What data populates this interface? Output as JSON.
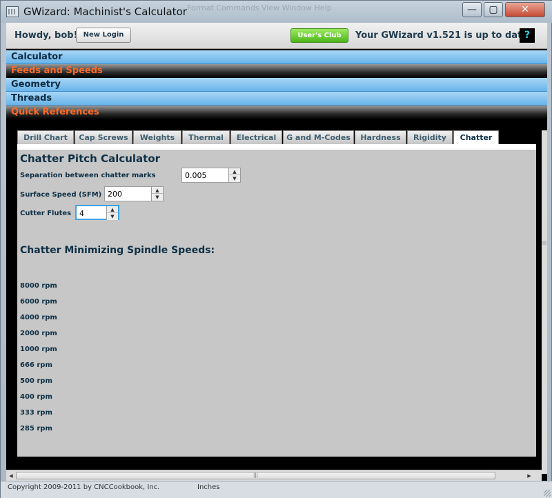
{
  "window": {
    "title": "GWizard: Machinist's Calculator",
    "ghost_menu": "Format    Commands    View    Window    Help",
    "controls": {
      "minimize": "—",
      "maximize": "▢",
      "close": "✕"
    }
  },
  "header": {
    "greeting": "Howdy, bob!",
    "new_login_label": "New Login",
    "users_club_label": "User's Club",
    "version_status": "Your GWizard v1.521 is up to date",
    "help_label": "?"
  },
  "sections": [
    {
      "label": "Calculator",
      "style": "blue"
    },
    {
      "label": "Feeds and Speeds",
      "style": "dark"
    },
    {
      "label": "Geometry",
      "style": "blue"
    },
    {
      "label": "Threads",
      "style": "blue"
    },
    {
      "label": "Quick References",
      "style": "dark"
    }
  ],
  "tabs": [
    {
      "label": "Drill Chart"
    },
    {
      "label": "Cap Screws"
    },
    {
      "label": "Weights"
    },
    {
      "label": "Thermal"
    },
    {
      "label": "Electrical"
    },
    {
      "label": "G and M-Codes"
    },
    {
      "label": "Hardness"
    },
    {
      "label": "Rigidity"
    },
    {
      "label": "Chatter",
      "active": true
    }
  ],
  "calculator": {
    "title": "Chatter Pitch Calculator",
    "separation_label": "Separation between chatter marks",
    "separation_value": "0.005",
    "sfm_label": "Surface Speed (SFM)",
    "sfm_value": "200",
    "flutes_label": "Cutter Flutes",
    "flutes_value": "4"
  },
  "results": {
    "title": "Chatter Minimizing Spindle Speeds:",
    "speeds": [
      "8000 rpm",
      "6000 rpm",
      "4000 rpm",
      "2000 rpm",
      "1000 rpm",
      "666 rpm",
      "500 rpm",
      "400 rpm",
      "333 rpm",
      "285 rpm"
    ]
  },
  "status": {
    "copyright": "Copyright 2009-2011 by CNCCookbook, Inc.",
    "units": "Inches"
  },
  "colors": {
    "accent_orange": "#ff6a26",
    "section_blue": "#68b4ea",
    "club_green": "#4db51b",
    "help_cyan": "#2ad3e8",
    "text_navy": "#0d2f45"
  },
  "icons": {
    "stepper_up": "▲",
    "stepper_down": "▼",
    "scroll_left": "◀",
    "scroll_right": "▶",
    "scroll_grip": "|||"
  }
}
